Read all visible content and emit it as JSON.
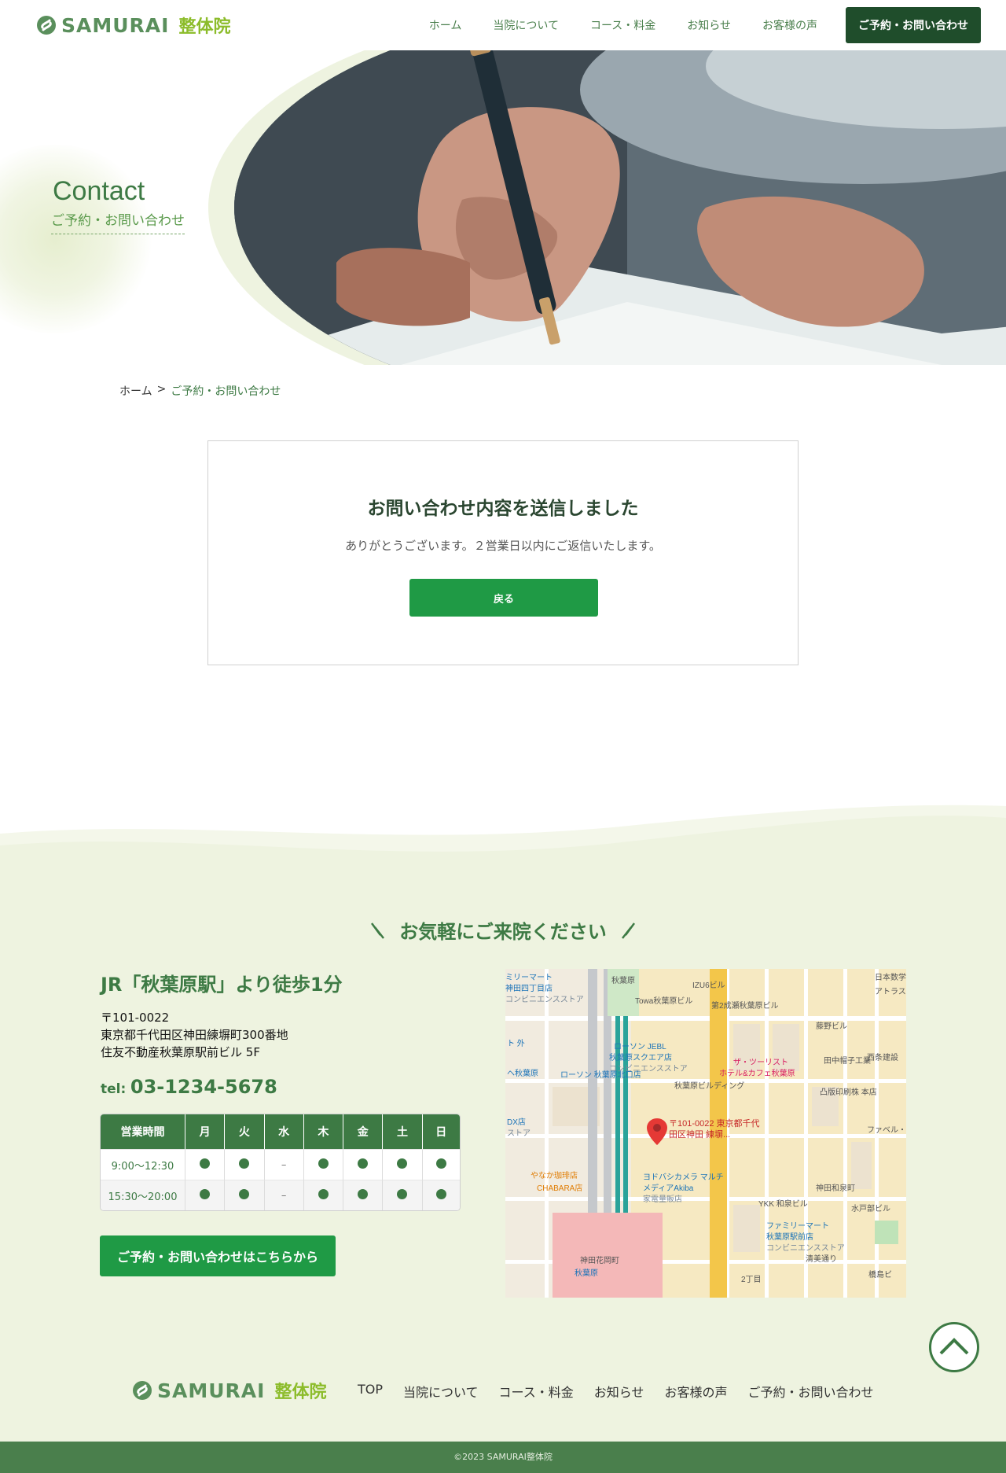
{
  "header": {
    "logo_text": "SAMURAI",
    "logo_sub": "整体院",
    "nav": [
      "ホーム",
      "当院について",
      "コース・料金",
      "お知らせ",
      "お客様の声"
    ],
    "cta": "ご予約・お問い合わせ"
  },
  "hero": {
    "title": "Contact",
    "subtitle": "ご予約・お問い合わせ"
  },
  "breadcrumb": {
    "home": "ホーム",
    "sep": ">",
    "current": "ご予約・お問い合わせ"
  },
  "message": {
    "title": "お問い合わせ内容を送信しました",
    "text": "ありがとうございます。２営業日以内にご返信いたします。",
    "button": "戻る"
  },
  "visit": {
    "title": "お気軽にご来院ください",
    "access": "JR「秋葉原駅」より徒歩1分",
    "postal": "〒101-0022",
    "address1": "東京都千代田区神田練塀町300番地",
    "address2": "住友不動産秋葉原駅前ビル 5F",
    "tel_label": "tel:",
    "tel_number": "03-1234-5678"
  },
  "hours": {
    "header": [
      "営業時間",
      "月",
      "火",
      "水",
      "木",
      "金",
      "土",
      "日"
    ],
    "rows": [
      {
        "time": "9:00〜12:30",
        "days": [
          "open",
          "open",
          "closed",
          "open",
          "open",
          "open",
          "open"
        ]
      },
      {
        "time": "15:30〜20:00",
        "days": [
          "open",
          "open",
          "closed",
          "open",
          "open",
          "open",
          "open"
        ]
      }
    ],
    "closed_mark": "–"
  },
  "reserve_button": "ご予約・お問い合わせはこちらから",
  "map": {
    "pin_label": "〒101-0022 東京都千代田区神田 練塀...",
    "labels": [
      {
        "text": "ミリーマート",
        "color": "#1a73b8"
      },
      {
        "text": "神田四丁目店",
        "color": "#1a73b8"
      },
      {
        "text": "コンビニエンスストア",
        "color": "#7a8a9a"
      },
      {
        "text": "秋葉原",
        "color": "#555"
      },
      {
        "text": "Towa秋葉原ビル",
        "color": "#555"
      },
      {
        "text": "IZU6ビル",
        "color": "#555"
      },
      {
        "text": "日本数学",
        "color": "#555"
      },
      {
        "text": "アトラス",
        "color": "#555"
      },
      {
        "text": "第2成瀬秋葉原ビル",
        "color": "#555"
      },
      {
        "text": "藤野ビル",
        "color": "#555"
      },
      {
        "text": "ト 外",
        "color": "#1a73b8"
      },
      {
        "text": "ローソン JEBL",
        "color": "#1a73b8"
      },
      {
        "text": "秋葉原スクエア店",
        "color": "#1a73b8"
      },
      {
        "text": "コンビニエンスストア",
        "color": "#7a8a9a"
      },
      {
        "text": "ザ・ツーリスト",
        "color": "#d81b60"
      },
      {
        "text": "ホテル&カフェ秋葉原",
        "color": "#d81b60"
      },
      {
        "text": "田中帽子工業",
        "color": "#555"
      },
      {
        "text": "西条建設",
        "color": "#555"
      },
      {
        "text": "ヘ秋葉原",
        "color": "#1a73b8"
      },
      {
        "text": "ローソン 秋葉原北口店",
        "color": "#1a73b8"
      },
      {
        "text": "秋葉原ビルディング",
        "color": "#555"
      },
      {
        "text": "凸版印刷株 本店",
        "color": "#555"
      },
      {
        "text": "DX店",
        "color": "#1a73b8"
      },
      {
        "text": "ストア",
        "color": "#7a8a9a"
      },
      {
        "text": "ファベル・ハウ",
        "color": "#555"
      },
      {
        "text": "やなか珈琲店",
        "color": "#e07b00"
      },
      {
        "text": "CHABARA店",
        "color": "#e07b00"
      },
      {
        "text": "ヨドバシカメラ マルチ",
        "color": "#1a73b8"
      },
      {
        "text": "メディアAkiba",
        "color": "#1a73b8"
      },
      {
        "text": "家電量販店",
        "color": "#7a8a9a"
      },
      {
        "text": "YKK 和泉ビル",
        "color": "#555"
      },
      {
        "text": "神田和泉町",
        "color": "#555"
      },
      {
        "text": "水戸部ビル",
        "color": "#555"
      },
      {
        "text": "ファミリーマート",
        "color": "#1a73b8"
      },
      {
        "text": "秋葉原駅前店",
        "color": "#1a73b8"
      },
      {
        "text": "コンビニエンスストア",
        "color": "#7a8a9a"
      },
      {
        "text": "清美通り",
        "color": "#555"
      },
      {
        "text": "神田花岡町",
        "color": "#555"
      },
      {
        "text": "秋葉原",
        "color": "#1a73b8"
      },
      {
        "text": "2丁目",
        "color": "#555"
      },
      {
        "text": "橋島ビ",
        "color": "#555"
      }
    ]
  },
  "footer": {
    "logo_text": "SAMURAI",
    "logo_sub": "整体院",
    "nav": [
      "TOP",
      "当院について",
      "コース・料金",
      "お知らせ",
      "お客様の声",
      "ご予約・お問い合わせ"
    ],
    "copyright": "©2023 SAMURAI整体院"
  },
  "colors": {
    "primary_green": "#3d7a44",
    "button_green": "#1f9a45",
    "dark_green": "#1f4d2b",
    "light_bg": "#eef3e0",
    "accent_lime": "#8cbc2a"
  }
}
